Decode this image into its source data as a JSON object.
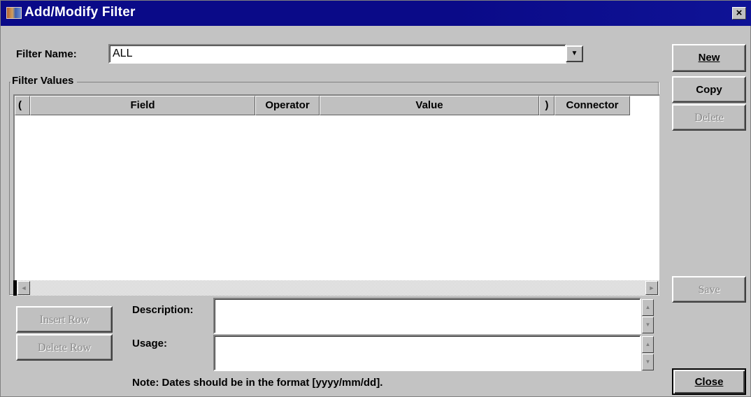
{
  "window": {
    "title": "Add/Modify Filter",
    "close_symbol": "×"
  },
  "filter_name": {
    "label": "Filter Name:",
    "value": "ALL",
    "dropdown_icon": "▼"
  },
  "filter_values": {
    "group_label": "Filter Values",
    "columns": [
      "(",
      "Field",
      "Operator",
      "Value",
      ")",
      "Connector"
    ]
  },
  "scroll": {
    "left_arrow": "◄",
    "right_arrow": "►",
    "up_arrow": "▲",
    "down_arrow": "▼"
  },
  "buttons": {
    "new": "New",
    "copy": "Copy",
    "delete": "Delete",
    "save": "Save",
    "close": "Close",
    "insert_row": "Insert Row",
    "delete_row": "Delete Row"
  },
  "description": {
    "label": "Description:",
    "value": ""
  },
  "usage": {
    "label": "Usage:",
    "value": ""
  },
  "note": "Note:  Dates should be in the format [yyyy/mm/dd].",
  "colors": {
    "title_bar": "#0a0a88",
    "dialog_bg": "#c3c3c3",
    "disabled_text": "#8a8a8a"
  }
}
